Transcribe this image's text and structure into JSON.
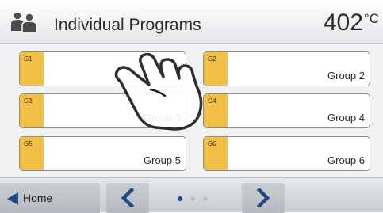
{
  "header": {
    "title": "Individual Programs",
    "icon": "user-group-icon",
    "temperature_value": "402",
    "temperature_unit": "°C"
  },
  "programs": [
    {
      "id": "G1",
      "name": ""
    },
    {
      "id": "G2",
      "name": "Group 2"
    },
    {
      "id": "G3",
      "name": "Group 3"
    },
    {
      "id": "G4",
      "name": "Group 4"
    },
    {
      "id": "G5",
      "name": "Group 5"
    },
    {
      "id": "G6",
      "name": "Group 6"
    }
  ],
  "footer": {
    "home_label": "Home",
    "home_icon": "arrow-left-icon",
    "prev_icon": "chevron-left-icon",
    "next_icon": "chevron-right-icon",
    "page_count": 3,
    "current_page": 1
  },
  "overlay": {
    "icon": "tap-hand-icon"
  },
  "colors": {
    "accent": "#1f4a86",
    "group_tag": "#f1c045",
    "dot_active": "#1f4a86",
    "dot_inactive": "#b7bdc4"
  }
}
